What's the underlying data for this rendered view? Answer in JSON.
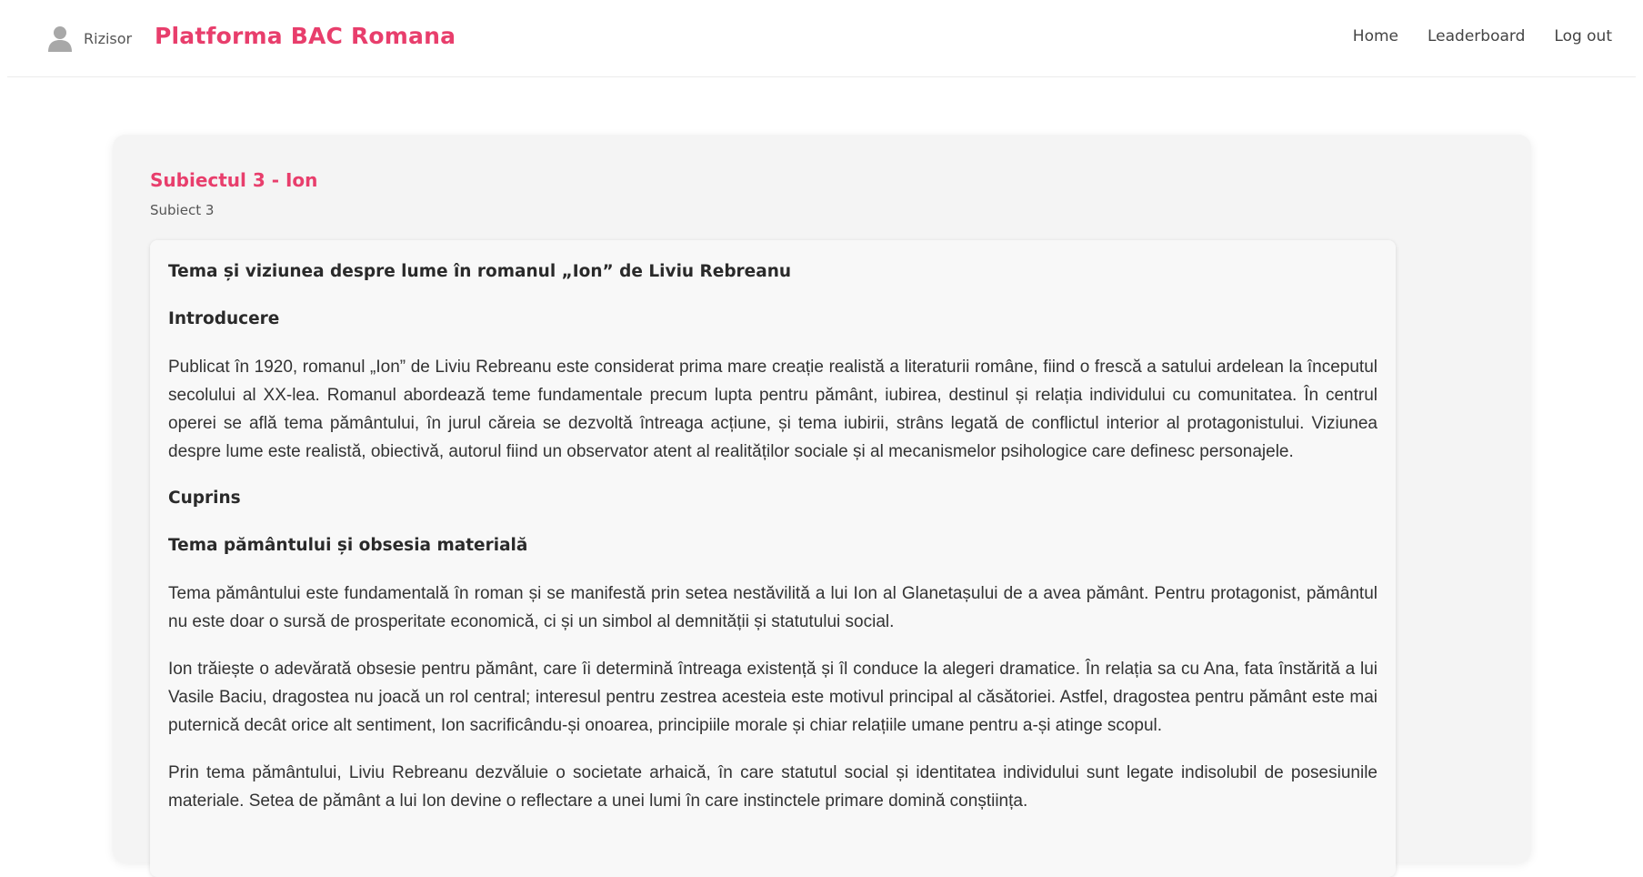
{
  "header": {
    "username": "Rizisor",
    "brand": "Platforma BAC Romana",
    "nav": [
      {
        "label": "Home"
      },
      {
        "label": "Leaderboard"
      },
      {
        "label": "Log out"
      }
    ],
    "icons": {
      "avatar": "user-avatar-icon"
    },
    "colors": {
      "brand": "#e83e6c"
    }
  },
  "card": {
    "title": "Subiectul 3 - Ion",
    "subtitle": "Subiect 3"
  },
  "essay": {
    "title": "Tema și viziunea despre lume în romanul „Ion” de Liviu Rebreanu",
    "intro_heading": "Introducere",
    "intro_paragraph": "Publicat în 1920, romanul „Ion” de Liviu Rebreanu este considerat prima mare creație realistă a literaturii române, fiind o frescă a satului ardelean la începutul secolului al XX-lea. Romanul abordează teme fundamentale precum lupta pentru pământ, iubirea, destinul și relația individului cu comunitatea. În centrul operei se află tema pământului, în jurul căreia se dezvoltă întreaga acțiune, și tema iubirii, strâns legată de conflictul interior al protagonistului. Viziunea despre lume este realistă, obiectivă, autorul fiind un observator atent al realităților sociale și al mecanismelor psihologice care definesc personajele.",
    "body_heading": "Cuprins",
    "section_heading": "Tema pământului și obsesia materială",
    "paragraphs": [
      "Tema pământului este fundamentală în roman și se manifestă prin setea nestăvilită a lui Ion al Glanetașului de a avea pământ. Pentru protagonist, pământul nu este doar o sursă de prosperitate economică, ci și un simbol al demnității și statutului social.",
      "Ion trăiește o adevărată obsesie pentru pământ, care îi determină întreaga existență și îl conduce la alegeri dramatice. În relația sa cu Ana, fata înstărită a lui Vasile Baciu, dragostea nu joacă un rol central; interesul pentru zestrea acesteia este motivul principal al căsătoriei. Astfel, dragostea pentru pământ este mai puternică decât orice alt sentiment, Ion sacrificându-și onoarea, principiile morale și chiar relațiile umane pentru a-și atinge scopul.",
      "Prin tema pământului, Liviu Rebreanu dezvăluie o societate arhaică, în care statutul social și identitatea individului sunt legate indisolubil de posesiunile materiale. Setea de pământ a lui Ion devine o reflectare a unei lumi în care instinctele primare domină conștiința."
    ]
  }
}
